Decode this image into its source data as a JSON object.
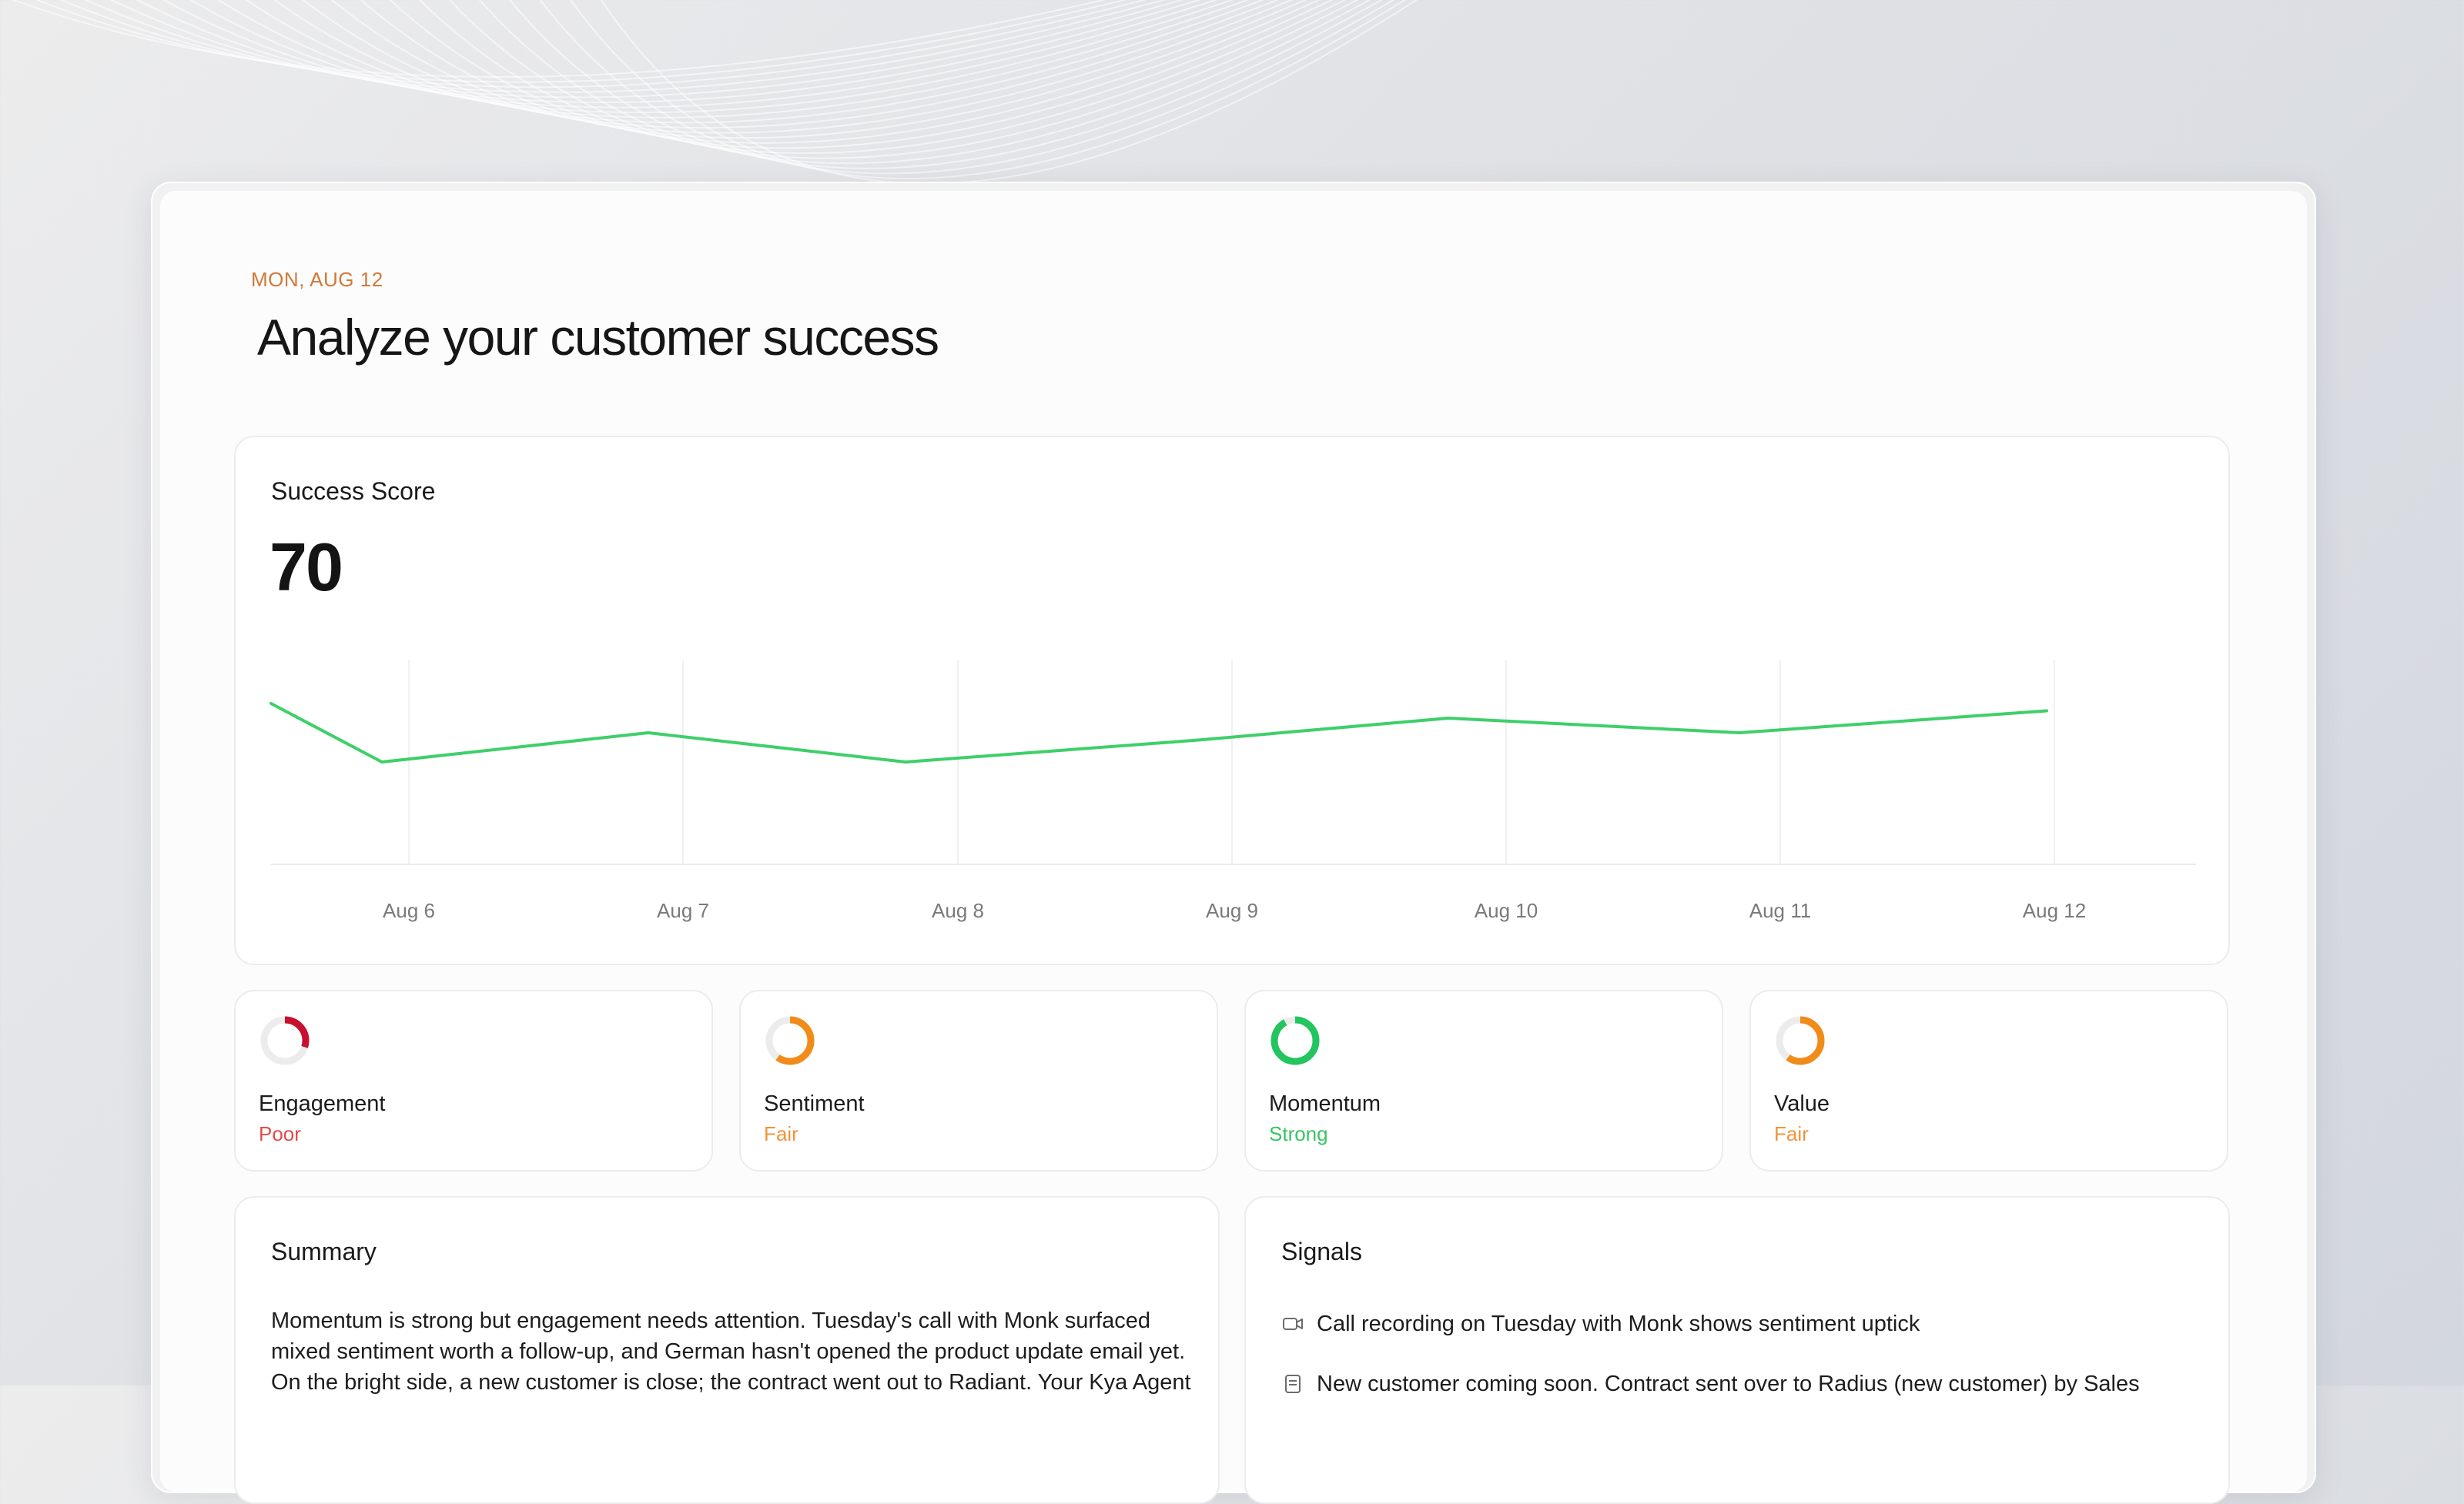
{
  "header": {
    "date": "MON, AUG 12",
    "title": "Analyze your customer success"
  },
  "success_score": {
    "title": "Success Score",
    "value": "70"
  },
  "chart_data": {
    "type": "line",
    "title": "Success Score",
    "x": [
      "Aug 6",
      "Aug 7",
      "Aug 8",
      "Aug 9",
      "Aug 10",
      "Aug 11",
      "Aug 12"
    ],
    "series": [
      {
        "values": [
          72,
          64,
          68,
          64,
          67,
          70,
          68,
          71
        ]
      }
    ],
    "note_points": "8 points across the visible range; first point sits left of Aug 6",
    "ylim": [
      50,
      80
    ],
    "grid": "vertical",
    "line_color": "#3fcf6a"
  },
  "metrics": [
    {
      "name": "Engagement",
      "status": "Poor",
      "level": 0.3,
      "color": "#c8102e"
    },
    {
      "name": "Sentiment",
      "status": "Fair",
      "level": 0.6,
      "color": "#f08c1a"
    },
    {
      "name": "Momentum",
      "status": "Strong",
      "level": 0.92,
      "color": "#22c55e"
    },
    {
      "name": "Value",
      "status": "Fair",
      "level": 0.6,
      "color": "#f08c1a"
    }
  ],
  "status_colors": {
    "Poor": "#e04b4b",
    "Fair": "#f0943c",
    "Strong": "#36c463"
  },
  "summary": {
    "title": "Summary",
    "text": "Momentum is strong but engagement needs attention. Tuesday's call with Monk surfaced mixed sentiment worth a follow-up, and German hasn't opened the product update email yet. On the bright side, a new customer is close; the contract went out to Radiant. Your Kya Agent"
  },
  "signals": {
    "title": "Signals",
    "items": [
      {
        "icon": "video-camera-icon",
        "text": "Call recording on Tuesday with Monk shows sentiment uptick"
      },
      {
        "icon": "document-icon",
        "text": "New customer coming soon. Contract sent over to Radius (new customer) by Sales"
      }
    ]
  }
}
